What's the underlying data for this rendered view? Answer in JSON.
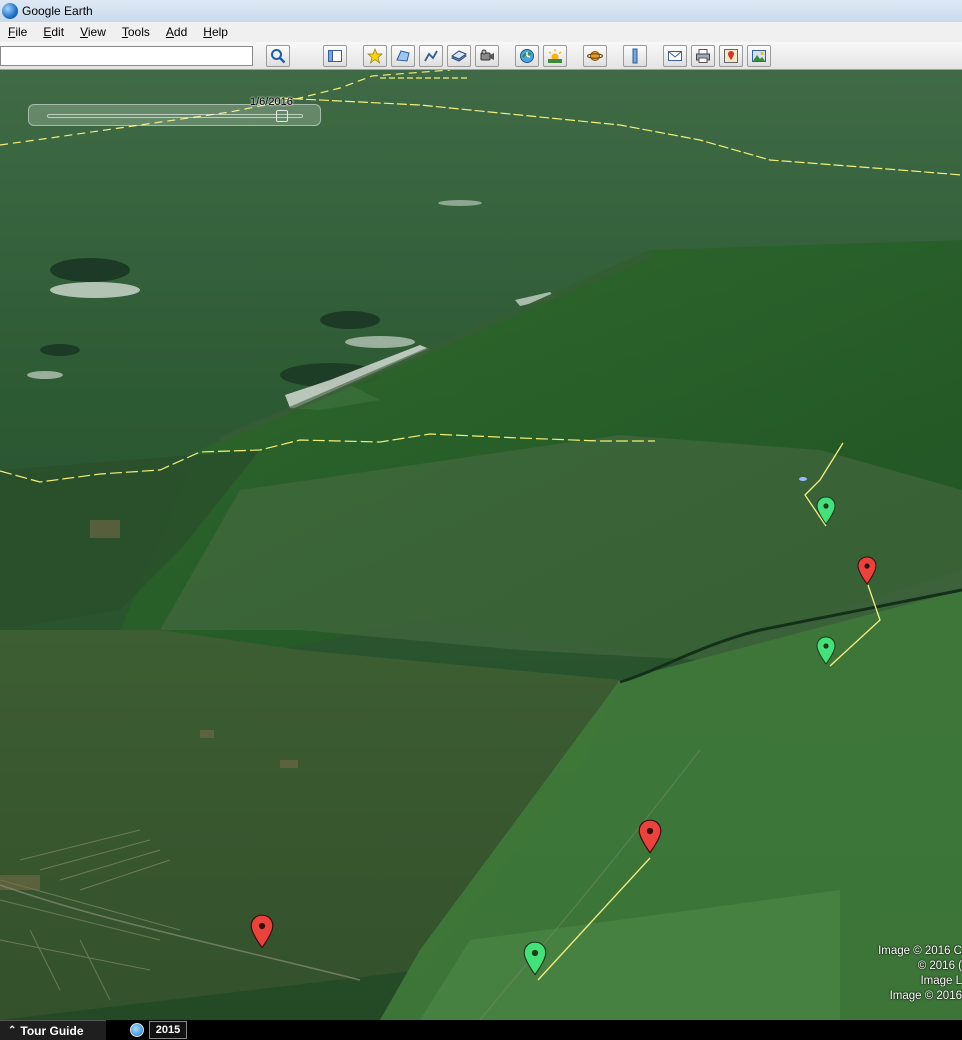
{
  "window": {
    "title": "Google Earth"
  },
  "menu": [
    "File",
    "Edit",
    "View",
    "Tools",
    "Add",
    "Help"
  ],
  "search": {
    "value": "",
    "placeholder": ""
  },
  "toolbar": {
    "icons": [
      "search-icon",
      "sidebar-toggle-icon",
      "add-placemark-icon",
      "add-polygon-icon",
      "add-path-icon",
      "image-overlay-icon",
      "record-tour-icon",
      "historical-imagery-icon",
      "sunlight-icon",
      "planets-icon",
      "ruler-icon",
      "email-icon",
      "print-icon",
      "google-maps-icon",
      "save-image-icon"
    ]
  },
  "time_slider": {
    "date": "1/6/2016",
    "position": 0.94
  },
  "attribution": [
    "Image © 2016 C",
    "© 2016 (",
    "Image L",
    "Image © 2016"
  ],
  "bottom": {
    "tour_guide": "Tour Guide",
    "year": "2015"
  },
  "colors": {
    "pin_red": "#e8433c",
    "pin_green": "#44e07a",
    "border_line": "#f3f07a",
    "path_line": "#f8f080"
  }
}
